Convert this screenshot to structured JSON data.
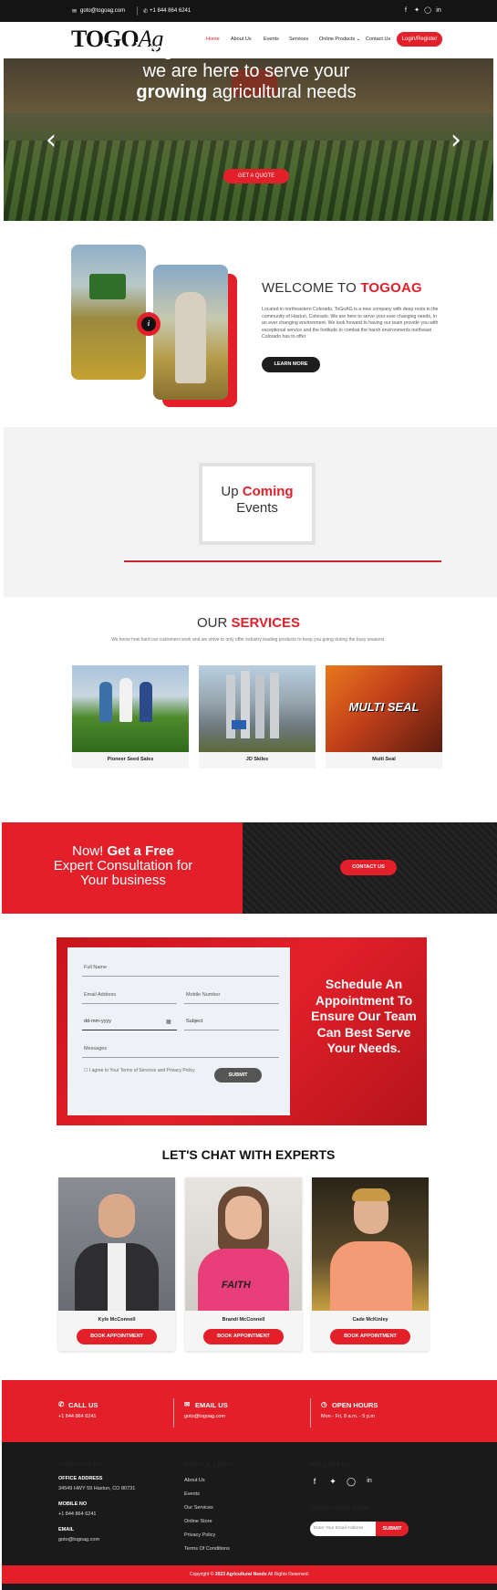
{
  "topbar": {
    "email": "goto@togoag.com",
    "phone": "+1 844 864 6241",
    "social_icons": [
      "facebook-icon",
      "twitter-icon",
      "instagram-icon",
      "linkedin-icon"
    ]
  },
  "brand": {
    "logo_main": "TOGO",
    "logo_ag": "Ag"
  },
  "nav": {
    "items": [
      "Home",
      "About Us",
      "Events",
      "Services",
      "Online Products ⌄",
      "Contact Us"
    ],
    "login_label": "Login/Register"
  },
  "hero": {
    "line1_a": "Residing in ",
    "line1_b": "Northeastern",
    "line1_c": " Colorado",
    "line2": "we are here to serve your",
    "line3_a": "growing",
    "line3_b": " agricultural needs",
    "button": "GET A QUOTE",
    "prev_icon": "‹",
    "next_icon": "›"
  },
  "welcome": {
    "title_a": "WELCOME TO ",
    "title_b": "TOGOAG",
    "body": "Located in northeastern Colorado, ToGoAG is a new company with deep roots in the community of Haxtun, Colorado. We are here to serve your ever changing needs, in an ever changing environment. We look forward to having our team provide you with exceptional service and the fortitude to combat the harsh environments northeast Colorado has to offer.",
    "button": "LEARN MORE",
    "play_icon": "i"
  },
  "events": {
    "title_a": "Up ",
    "title_b": "Coming",
    "title_c": "Events"
  },
  "services": {
    "title_a": "OUR ",
    "title_b": "SERVICES",
    "subtitle": "We know how hard our customers work and we strive to only offer industry leading products to keep you going during the busy seasons.",
    "cards": [
      {
        "label": "Pioneer Seed Sales"
      },
      {
        "label": "JD Skiles"
      },
      {
        "label": "Multi Seal",
        "overlay": "MULTI SEAL"
      }
    ]
  },
  "consult": {
    "line1_a": "Now! ",
    "line1_b": "Get a Free",
    "line2": "Expert Consultation for",
    "line3": "Your business",
    "button": "CONTACT US"
  },
  "form": {
    "full_name": "Full Name",
    "email": "Email Address",
    "mobile": "Mobile Number",
    "date": "dd-mm-yyyy",
    "subject": "Subject",
    "messages": "Messages",
    "agree": "I agree to Your Terms of Services and Privacy Policy",
    "submit": "SUBMIT",
    "schedule": "Schedule An Appointment To Ensure Our Team Can Best Serve Your Needs."
  },
  "experts": {
    "title": "LET'S CHAT WITH EXPERTS",
    "people": [
      {
        "name": "Kyle McConnell",
        "button": "BOOK APPOINTMENT"
      },
      {
        "name": "Brandi McConnell",
        "button": "BOOK APPOINTMENT",
        "shirt_text": "FAITH"
      },
      {
        "name": "Cade McKinley",
        "button": "BOOK APPOINTMENT"
      }
    ]
  },
  "contact_bar": {
    "call_label": "CALL US",
    "call_value": "+1 844 864 6241",
    "email_label": "EMAIL US",
    "email_value": "goto@togoag.com",
    "hours_label": "OPEN HOURS",
    "hours_value": "Mon - Fri, 8 a.m. - 5 p.m"
  },
  "footer": {
    "contact_title": "CONTACT US",
    "office_label": "OFFICE ADDRESS",
    "office_value": "34549 HWY 59 Haxtun, CO 80731",
    "mobile_label": "MOBILE NO",
    "mobile_value": "+1 844 864 6241",
    "email_label": "EMAIL",
    "email_value": "goto@togoag.com",
    "links_title": "USEFUL LINKS",
    "links": [
      "About Us",
      "Events",
      "Our Services",
      "Online Store",
      "Privacy Policy",
      "Terms Of Conditions"
    ],
    "follow_title": "FOLLOW US",
    "subscribe_title": "SUBSCRIBE NOW",
    "subscribe_placeholder": "Enter Your Email Address",
    "subscribe_button": "SUBMIT",
    "copyright_a": "Copyright © ",
    "copyright_b": "2023 Agricultural Needs",
    "copyright_c": " All Rights Reserved."
  },
  "colors": {
    "accent": "#e3202a",
    "dark": "#1a1a1a"
  }
}
